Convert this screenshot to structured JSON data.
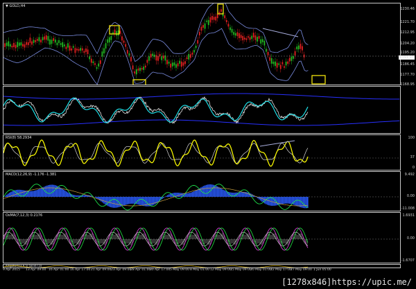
{
  "window": {
    "symbol_label": "GOLD,H4",
    "menu_arrow": "▼"
  },
  "price_pane": {
    "scale": [
      "1230.46",
      "1221.70",
      "1212.95",
      "1204.20",
      "1195.20",
      "1186.45",
      "1177.70",
      "1168.95"
    ],
    "current_price": "1191.95"
  },
  "osc1_pane": {
    "scale": []
  },
  "rsi_pane": {
    "label": "RSI(8) 58.2934",
    "scale": [
      "100",
      "37",
      "0"
    ]
  },
  "macd_pane": {
    "label": "MACD(12,26,9) -1.176 -1.381",
    "scale": [
      "9.492",
      "0.00",
      "-11.008"
    ]
  },
  "osma_pane": {
    "label": "OsMA(7,12,3) 0.2176",
    "scale": [
      "1.6931",
      "0.00",
      "-1.6707"
    ]
  },
  "bottom_pane": {
    "label": "Alligator(13,8,5) 58.8(7,0)"
  },
  "time_axis": [
    "9 Apr 2015",
    "13 Apr 09:00",
    "16 Apr 01:00",
    "16 Apr 17:00",
    "21 Apr 09:00",
    "23 Apr 09:00",
    "28 Apr 01:00",
    "30 Apr 17:00",
    "5 May 09:00",
    "8 May 01:00",
    "12 May 09:00",
    "15 May 09:00",
    "20 May 01:00",
    "22 May 17:00",
    "27 May 09:00",
    "1 Jun 05:00"
  ],
  "watermark": "[1278x846]https://upic.me/",
  "colors": {
    "background": "#000000",
    "highlight": "#f2e40c",
    "bull": "#22b822",
    "bear": "#e02020",
    "macd_hist": "#2a5cff",
    "rsi": "#f5f500",
    "divergence": "#ff2bff"
  }
}
